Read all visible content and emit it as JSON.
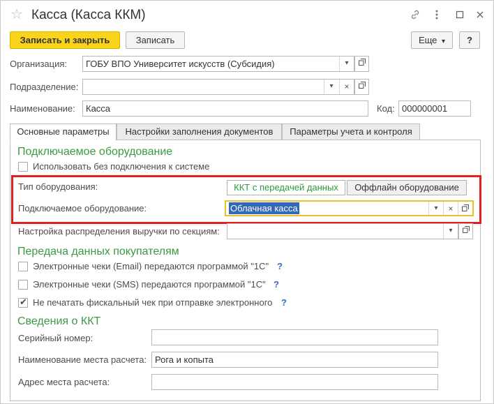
{
  "window": {
    "title": "Касса (Касса ККМ)",
    "star_icon": "star-icon",
    "link_icon": "link-icon",
    "more_icon": "more-vertical-icon",
    "maximize_icon": "maximize-icon",
    "close_icon": "close-icon"
  },
  "toolbar": {
    "save_close_label": "Записать и закрыть",
    "save_label": "Записать",
    "more_label": "Еще",
    "more_arrow": "▾",
    "help_label": "?"
  },
  "form": {
    "organization": {
      "label": "Организация:",
      "value": "ГОБУ ВПО Университет искусств (Субсидия)"
    },
    "department": {
      "label": "Подразделение:",
      "value": ""
    },
    "name": {
      "label": "Наименование:",
      "value": "Касса"
    },
    "code": {
      "label": "Код:",
      "value": "000000001"
    }
  },
  "tabs": [
    {
      "label": "Основные параметры",
      "active": true
    },
    {
      "label": "Настройки заполнения документов",
      "active": false
    },
    {
      "label": "Параметры учета и контроля",
      "active": false
    }
  ],
  "equipment": {
    "heading": "Подключаемое оборудование",
    "no_connect_label": "Использовать без подключения к системе",
    "no_connect_checked": false,
    "type_label": "Тип оборудования:",
    "type_options": [
      "ККТ с передачей данных",
      "Оффлайн оборудование"
    ],
    "type_selected": "ККТ с передачей данных",
    "device_label": "Подключаемое оборудование:",
    "device_value": "Облачная касса",
    "revenue_label": "Настройка распределения выручки по секциям:",
    "revenue_value": ""
  },
  "buyer": {
    "heading": "Передача данных покупателям",
    "email_label": "Электронные чеки (Email) передаются программой \"1С\"",
    "email_checked": false,
    "sms_label": "Электронные чеки (SMS) передаются программой \"1С\"",
    "sms_checked": false,
    "noprint_label": "Не печатать фискальный чек при отправке электронного",
    "noprint_checked": true,
    "help": "?"
  },
  "kkt": {
    "heading": "Сведения о ККТ",
    "serial_label": "Серийный номер:",
    "serial_value": "",
    "place_name_label": "Наименование места расчета:",
    "place_name_value": "Рога и копыта",
    "place_address_label": "Адрес места расчета:",
    "place_address_value": ""
  },
  "colors": {
    "accent_yellow": "#fad41a",
    "section_green": "#3a9a43",
    "highlight_red": "#e02020",
    "selection_blue": "#3166b8"
  }
}
